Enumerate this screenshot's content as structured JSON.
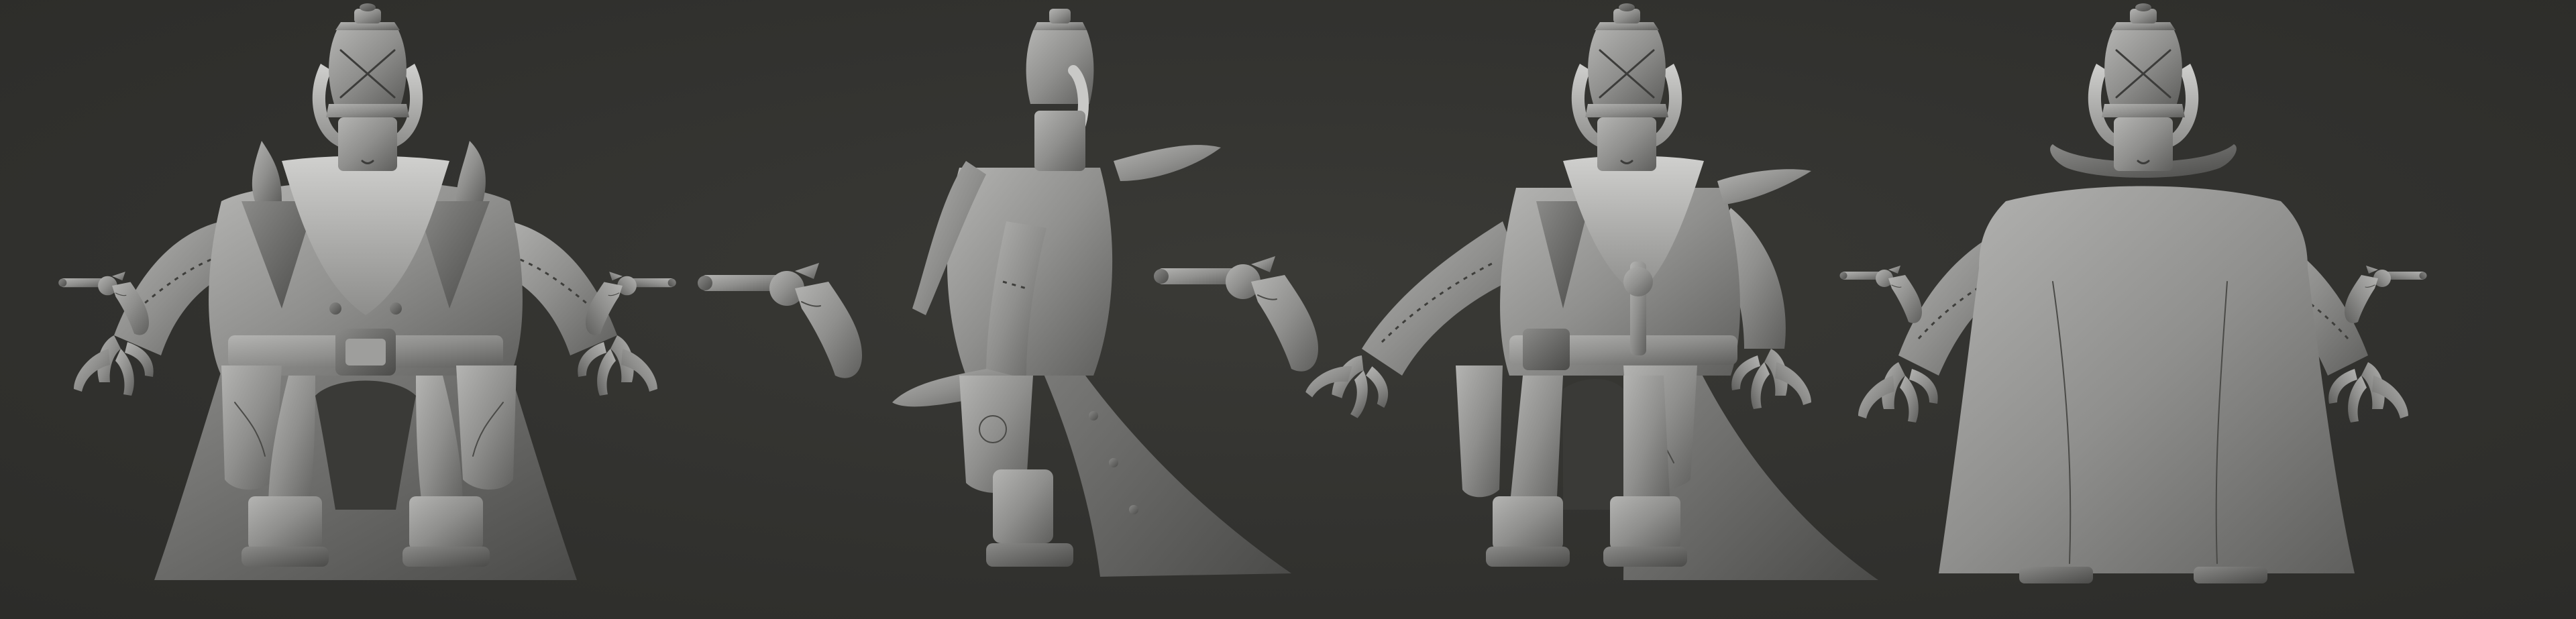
{
  "scene": {
    "background_color": "#30302d",
    "material_color": "#9a9a98",
    "views": [
      {
        "name": "front"
      },
      {
        "name": "side"
      },
      {
        "name": "three-quarter"
      },
      {
        "name": "back"
      }
    ],
    "props": [
      {
        "name": "revolver-left-of-side-view"
      },
      {
        "name": "revolver-left-of-three-quarter-view"
      }
    ]
  }
}
